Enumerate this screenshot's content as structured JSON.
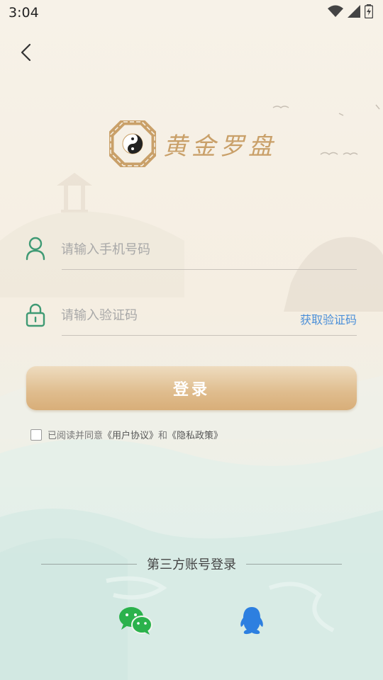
{
  "status_bar": {
    "time": "3:04"
  },
  "header": {
    "back_icon": "chevron-left-icon"
  },
  "logo": {
    "text": "黄金罗盘",
    "icon": "bagua-icon"
  },
  "form": {
    "phone_placeholder": "请输入手机号码",
    "code_placeholder": "请输入验证码",
    "get_code_label": "获取验证码",
    "login_label": "登录"
  },
  "agreement": {
    "prefix": "已阅读并同意",
    "user_agreement": "《用户协议》",
    "and": "和",
    "privacy_policy": "《隐私政策》"
  },
  "third_party": {
    "title": "第三方账号登录",
    "wechat_icon": "wechat-icon",
    "qq_icon": "qq-icon"
  },
  "colors": {
    "accent_gold": "#c9a069",
    "link_blue": "#4b8fd8",
    "icon_green": "#3f9a74"
  }
}
